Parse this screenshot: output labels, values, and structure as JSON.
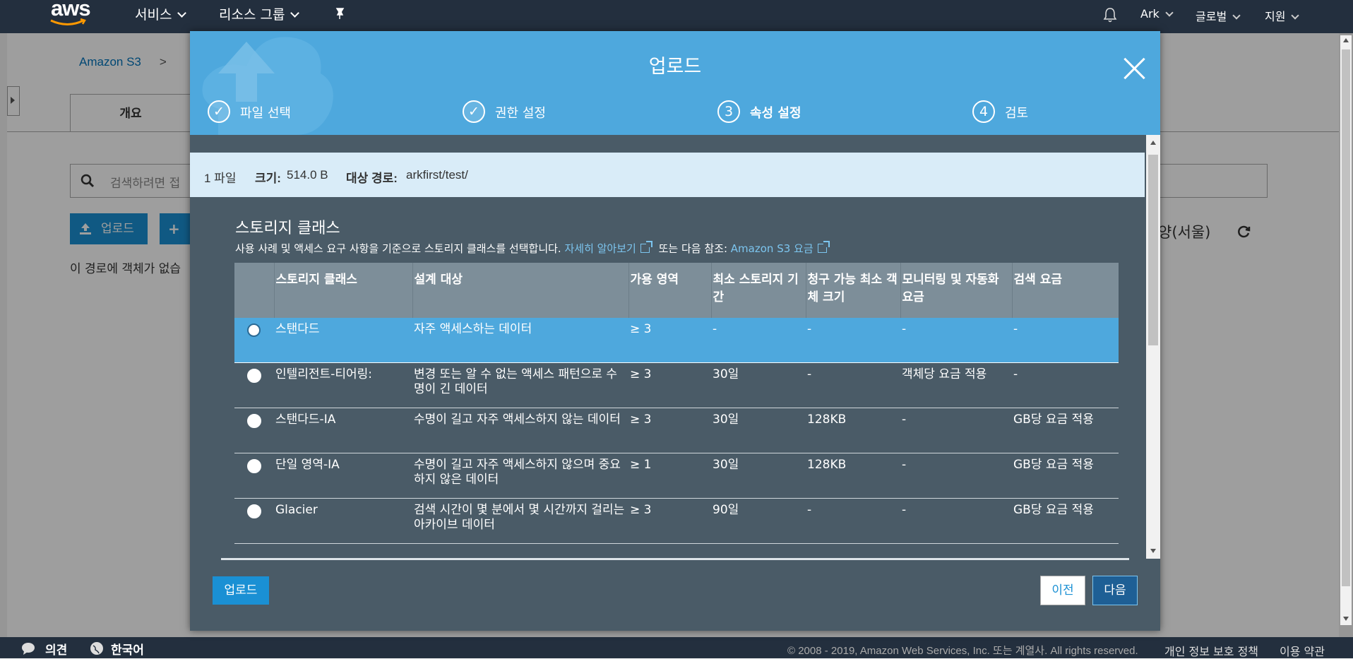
{
  "topnav": {
    "logo_text": "aws",
    "services": "서비스",
    "resource_groups": "리소스 그룹",
    "account": "Ark",
    "region": "글로벌",
    "support": "지원"
  },
  "background": {
    "breadcrumb_root": "Amazon S3",
    "breadcrumb_sep": ">",
    "tab_overview": "개요",
    "search_placeholder": "검색하려면 접",
    "upload_button": "업로드",
    "create_folder_button": "+",
    "empty_message": "이 경로에 객체가 없습",
    "region_label": "양(서울)"
  },
  "modal": {
    "title": "업로드",
    "steps": [
      {
        "num": "✓",
        "label": "파일 선택"
      },
      {
        "num": "✓",
        "label": "권한 설정"
      },
      {
        "num": "3",
        "label": "속성 설정"
      },
      {
        "num": "4",
        "label": "검토"
      }
    ],
    "info": {
      "file_count": "1 파일",
      "size_label": "크기:",
      "size_value": "514.0 B",
      "dest_label": "대상 경로:",
      "dest_value": "arkfirst/test/"
    },
    "storage_class": {
      "title": "스토리지 클래스",
      "desc": "사용 사례 및 액세스 요구 사항을 기준으로 스토리지 클래스를 선택합니다.",
      "learn_more": "자세히 알아보기",
      "or_see": "또는 다음 참조:",
      "pricing_link": "Amazon S3 요금",
      "headers": [
        "",
        "스토리지 클래스",
        "설계 대상",
        "가용 영역",
        "최소 스토리지 기간",
        "청구 가능 최소 객체 크기",
        "모니터링 및 자동화 요금",
        "검색 요금"
      ],
      "rows": [
        [
          "스탠다드",
          "자주 액세스하는 데이터",
          "≥ 3",
          "-",
          "-",
          "-",
          "-"
        ],
        [
          "인텔리전트-티어링:",
          "변경 또는 알 수 없는 액세스 패턴으로 수명이 긴 데이터",
          "≥ 3",
          "30일",
          "-",
          "객체당 요금 적용",
          "-"
        ],
        [
          "스탠다드-IA",
          "수명이 길고 자주 액세스하지 않는 데이터",
          "≥ 3",
          "30일",
          "128KB",
          "-",
          "GB당 요금 적용"
        ],
        [
          "단일 영역-IA",
          "수명이 길고 자주 액세스하지 않으며 중요하지 않은 데이터",
          "≥ 1",
          "30일",
          "128KB",
          "-",
          "GB당 요금 적용"
        ],
        [
          "Glacier",
          "검색 시간이 몇 분에서 몇 시간까지 걸리는 아카이브 데이터",
          "≥ 3",
          "90일",
          "-",
          "-",
          "GB당 요금 적용"
        ]
      ]
    },
    "buttons": {
      "upload": "업로드",
      "prev": "이전",
      "next": "다음"
    }
  },
  "footer": {
    "feedback": "의견",
    "language": "한국어",
    "copyright": "© 2008 - 2019, Amazon Web Services, Inc. 또는 계열사. All rights reserved.",
    "privacy": "개인 정보 보호 정책",
    "terms": "이용 약관"
  },
  "colors": {
    "nav": "#232f3e",
    "modal_header": "#4ea8dd",
    "modal_body": "#4a5b67",
    "primary": "#1a90d4"
  }
}
